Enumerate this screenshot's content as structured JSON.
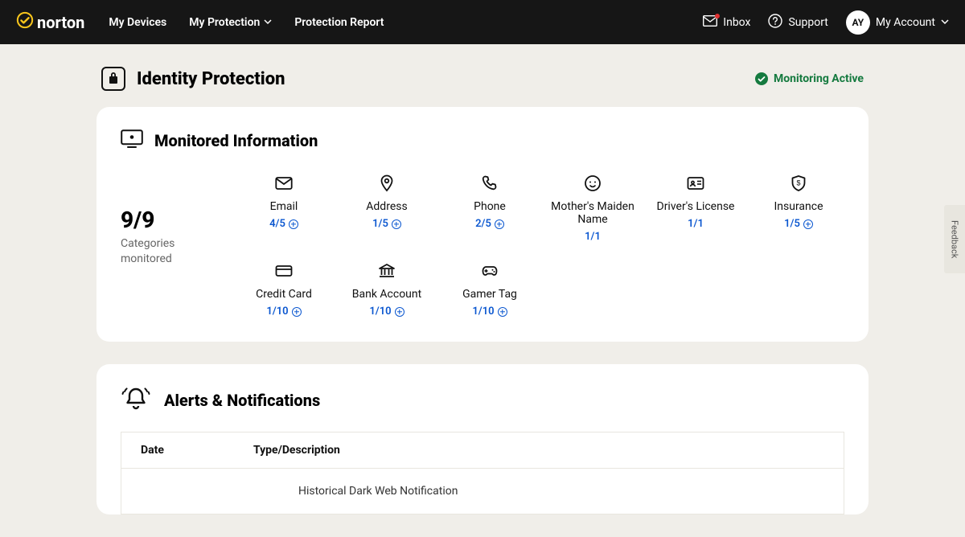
{
  "nav": {
    "brand": "norton",
    "links": {
      "devices": "My Devices",
      "protection": "My Protection",
      "report": "Protection Report"
    },
    "right": {
      "inbox": "Inbox",
      "support": "Support",
      "avatar_initials": "AY",
      "account": "My Account"
    }
  },
  "page": {
    "title": "Identity Protection",
    "status": "Monitoring Active"
  },
  "monitored": {
    "card_title": "Monitored Information",
    "summary_count": "9/9",
    "summary_label": "Categories monitored",
    "items": {
      "email": {
        "label": "Email",
        "count": "4/5"
      },
      "address": {
        "label": "Address",
        "count": "1/5"
      },
      "phone": {
        "label": "Phone",
        "count": "2/5"
      },
      "mmn": {
        "label": "Mother's Maiden Name",
        "count": "1/1"
      },
      "dl": {
        "label": "Driver's License",
        "count": "1/1"
      },
      "ins": {
        "label": "Insurance",
        "count": "1/5"
      },
      "cc": {
        "label": "Credit Card",
        "count": "1/10"
      },
      "bank": {
        "label": "Bank Account",
        "count": "1/10"
      },
      "gamer": {
        "label": "Gamer Tag",
        "count": "1/10"
      }
    }
  },
  "alerts": {
    "card_title": "Alerts & Notifications",
    "columns": {
      "date": "Date",
      "desc": "Type/Description"
    },
    "rows": [
      {
        "date": "",
        "desc": "Historical Dark Web Notification"
      }
    ]
  },
  "feedback": {
    "label": "Feedback"
  }
}
